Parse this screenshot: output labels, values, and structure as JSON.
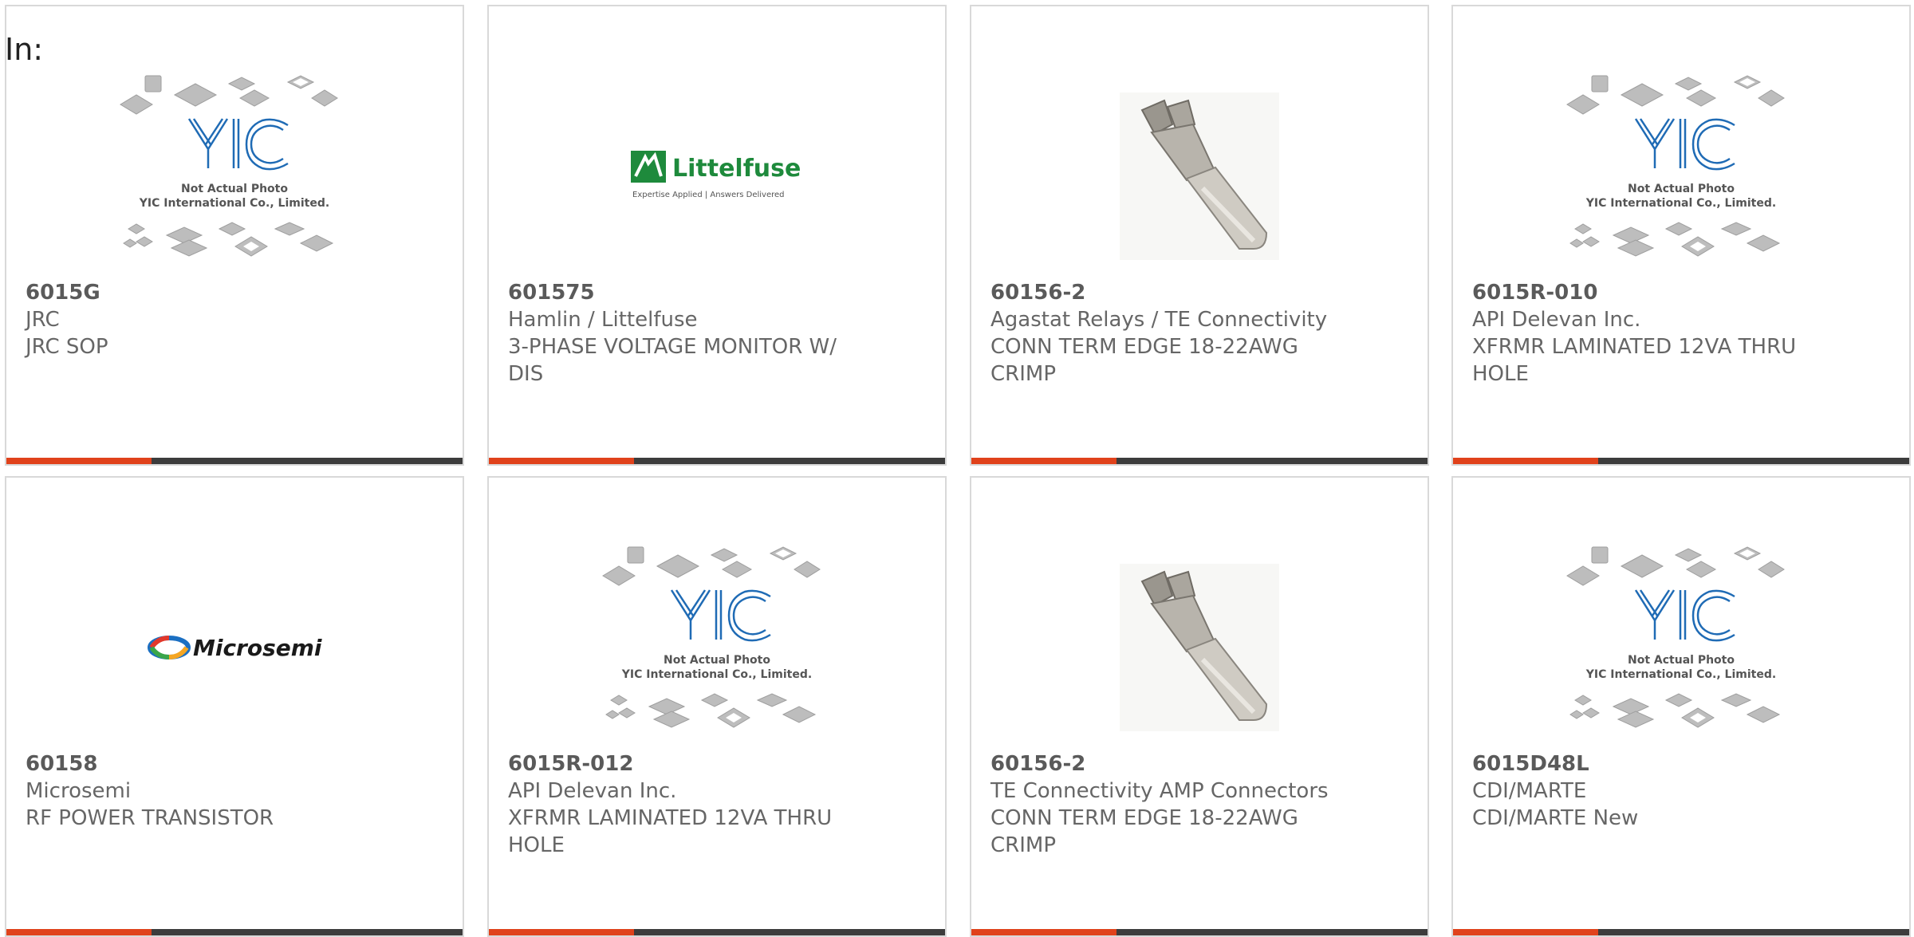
{
  "heading": "In:",
  "accent_color": "#e0421b",
  "bar_color": "#3c3c3c",
  "cards": [
    {
      "part_number": "6015G",
      "manufacturer": "JRC",
      "description": "JRC SOP",
      "image": "placeholder",
      "image_lines": [
        "Not Actual Photo",
        "YIC International Co., Limited."
      ]
    },
    {
      "part_number": "601575",
      "manufacturer": "Hamlin / Littelfuse",
      "description": "3-PHASE VOLTAGE MONITOR W/ DIS",
      "image": "littelfuse-logo",
      "logo_name": "Littelfuse",
      "logo_tagline": "Expertise Applied | Answers Delivered"
    },
    {
      "part_number": "60156-2",
      "manufacturer": "Agastat Relays / TE Connectivity",
      "description": "CONN TERM EDGE 18-22AWG CRIMP",
      "image": "crimp-terminal"
    },
    {
      "part_number": "6015R-010",
      "manufacturer": "API Delevan Inc.",
      "description": "XFRMR LAMINATED 12VA THRU HOLE",
      "image": "placeholder",
      "image_lines": [
        "Not Actual Photo",
        "YIC International Co., Limited."
      ]
    },
    {
      "part_number": "60158",
      "manufacturer": "Microsemi",
      "description": "RF POWER TRANSISTOR",
      "image": "microsemi-logo",
      "logo_name": "Microsemi"
    },
    {
      "part_number": "6015R-012",
      "manufacturer": "API Delevan Inc.",
      "description": "XFRMR LAMINATED 12VA THRU HOLE",
      "image": "placeholder",
      "image_lines": [
        "Not Actual Photo",
        "YIC International Co., Limited."
      ]
    },
    {
      "part_number": "60156-2",
      "manufacturer": "TE Connectivity AMP Connectors",
      "description": "CONN TERM EDGE 18-22AWG CRIMP",
      "image": "crimp-terminal"
    },
    {
      "part_number": "6015D48L",
      "manufacturer": "CDI/MARTE",
      "description": "CDI/MARTE New",
      "image": "placeholder",
      "image_lines": [
        "Not Actual Photo",
        "YIC International Co., Limited."
      ]
    }
  ]
}
